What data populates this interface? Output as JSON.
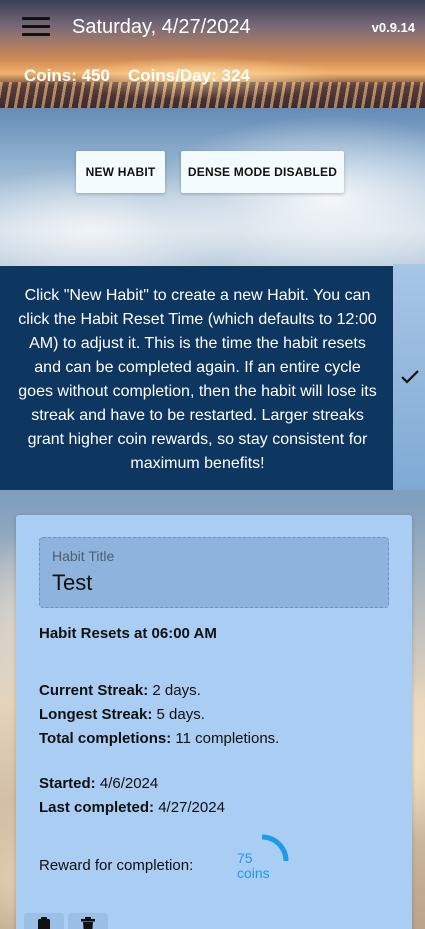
{
  "header": {
    "date": "Saturday, 4/27/2024",
    "version": "v0.9.14",
    "coins": "Coins: 450",
    "coins_per_day": "Coins/Day: 324"
  },
  "toolbar": {
    "new_habit_label": "NEW HABIT",
    "dense_mode_label": "DENSE MODE DISABLED"
  },
  "info": {
    "text": "Click \"New Habit\" to create a new Habit. You can click the Habit Reset Time (which defaults to 12:00 AM) to adjust it. This is the time the habit resets and can be completed again. If an entire cycle goes without completion, then the habit will lose its streak and have to be restarted. Larger streaks grant higher coin rewards, so stay consistent for maximum benefits!",
    "dismiss_icon": "checkmark-icon"
  },
  "habit": {
    "title_label": "Habit Title",
    "title_value": "Test",
    "reset_time": "Habit Resets at 06:00 AM",
    "current_streak_label": "Current Streak:",
    "current_streak_value": " 2 days.",
    "longest_streak_label": "Longest Streak:",
    "longest_streak_value": " 5 days.",
    "total_completions_label": "Total completions:",
    "total_completions_value": " 11 completions.",
    "started_label": "Started:",
    "started_value": " 4/6/2024",
    "last_completed_label": "Last completed:",
    "last_completed_value": " 4/27/2024",
    "reward_label": "Reward for completion:",
    "reward_amount": "75",
    "reward_unit": "coins",
    "reward_progress": 0.25,
    "accent_color": "#1e9be8"
  }
}
